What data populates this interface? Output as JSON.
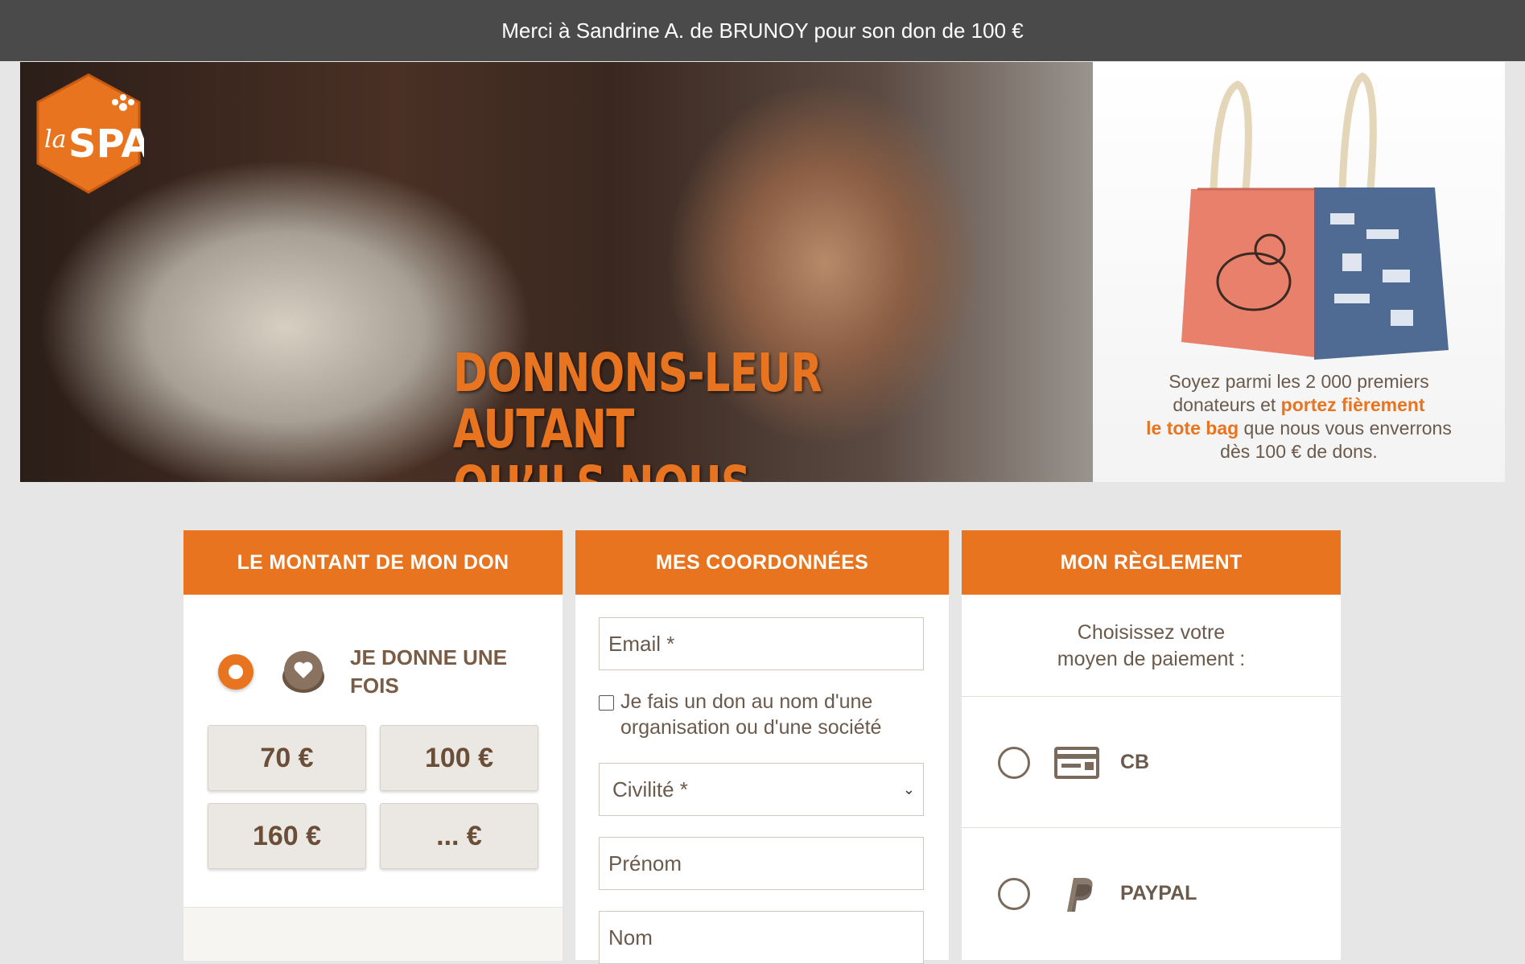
{
  "topbar": {
    "message": "Merci à Sandrine A. de BRUNOY pour son don de 100 €"
  },
  "banner": {
    "logo_text": "laSPA",
    "slogan_line1": "DONNONS-LEUR AUTANT",
    "slogan_line2": "QU’ILS NOUS APPORTENT",
    "promo": {
      "line1": "Soyez parmi les 2 000 premiers",
      "line2_a": "donateurs et ",
      "line2_hl": "portez fièrement",
      "line3_hl": "le tote bag",
      "line3_b": " que nous vous enverrons",
      "line4": "dès 100 € de dons."
    }
  },
  "donation": {
    "header": "LE MONTANT DE MON DON",
    "frequency_label": "JE DONNE UNE FOIS",
    "amounts": [
      "70 €",
      "100 €",
      "160 €",
      "... €"
    ]
  },
  "contact": {
    "header": "MES COORDONNÉES",
    "email_placeholder": "Email *",
    "org_checkbox_label": "Je fais un don au nom d'une organisation ou d'une société",
    "civility_placeholder": "Civilité *",
    "firstname_placeholder": "Prénom",
    "lastname_placeholder": "Nom"
  },
  "payment": {
    "header": "MON RÈGLEMENT",
    "intro_line1": "Choisissez votre",
    "intro_line2": "moyen de paiement :",
    "methods": [
      {
        "label": "CB",
        "icon": "credit-card-icon"
      },
      {
        "label": "PAYPAL",
        "icon": "paypal-icon"
      }
    ]
  },
  "colors": {
    "accent": "#e8741f",
    "brown_text": "#6b5a4c",
    "topbar": "#4a4a4a"
  }
}
